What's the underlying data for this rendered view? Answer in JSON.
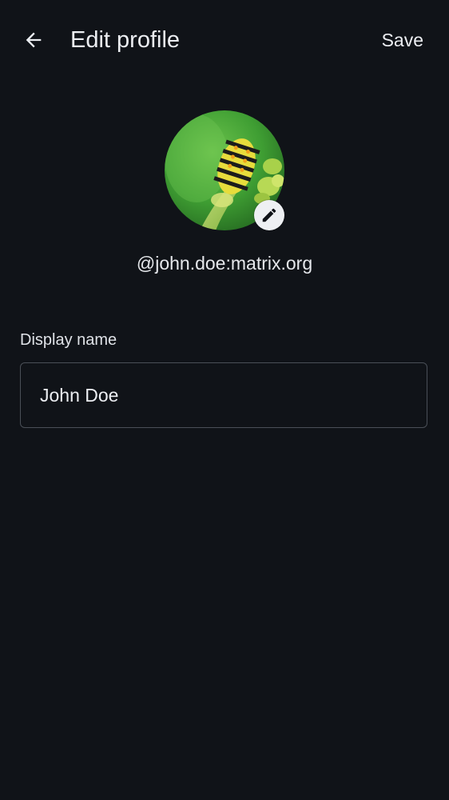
{
  "header": {
    "title": "Edit profile",
    "save_label": "Save"
  },
  "profile": {
    "user_id": "@john.doe:matrix.org"
  },
  "display_name": {
    "label": "Display name",
    "value": "John Doe"
  },
  "icons": {
    "back": "arrow-back-icon",
    "edit": "pencil-icon"
  },
  "colors": {
    "background": "#101318",
    "text": "#eceef2",
    "field_border": "#4a4f57",
    "badge": "#eef0f3"
  }
}
